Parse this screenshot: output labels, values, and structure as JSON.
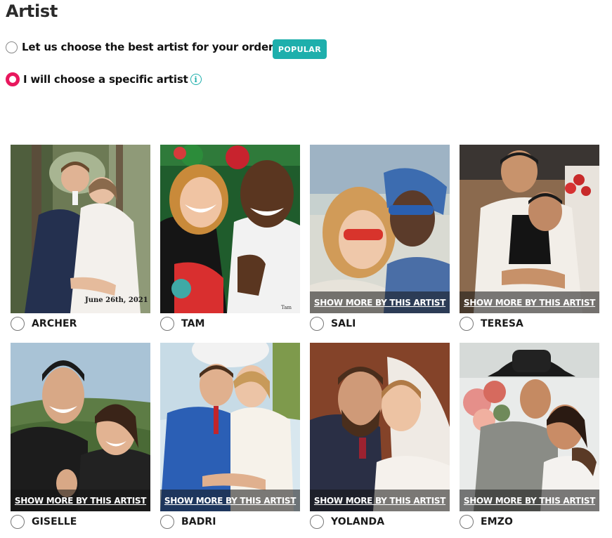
{
  "section_title": "Artist",
  "options": {
    "auto": {
      "label": "Let us choose the best artist for your order",
      "selected": false
    },
    "popular_badge": "POPULAR",
    "specific": {
      "label": "I will choose a specific artist",
      "selected": true
    }
  },
  "show_more_label": "SHOW MORE BY THIS ARTIST",
  "artists": [
    {
      "name": "ARCHER",
      "show_more": "",
      "date_text": "June 26th, 2021"
    },
    {
      "name": "TAM",
      "show_more": "",
      "signature": "Tam"
    },
    {
      "name": "SALI",
      "show_more": "SHOW MORE BY THIS ARTIST"
    },
    {
      "name": "TERESA",
      "show_more": "SHOW MORE BY THIS ARTIST"
    },
    {
      "name": "GISELLE",
      "show_more": "SHOW MORE BY THIS ARTIST"
    },
    {
      "name": "BADRI",
      "show_more": "SHOW MORE BY THIS ARTIST"
    },
    {
      "name": "YOLANDA",
      "show_more": "SHOW MORE BY THIS ARTIST"
    },
    {
      "name": "EMZO",
      "show_more": "SHOW MORE BY THIS ARTIST"
    }
  ],
  "colors": {
    "accent": "#1eafac",
    "selected_radio": "#e8175d"
  }
}
